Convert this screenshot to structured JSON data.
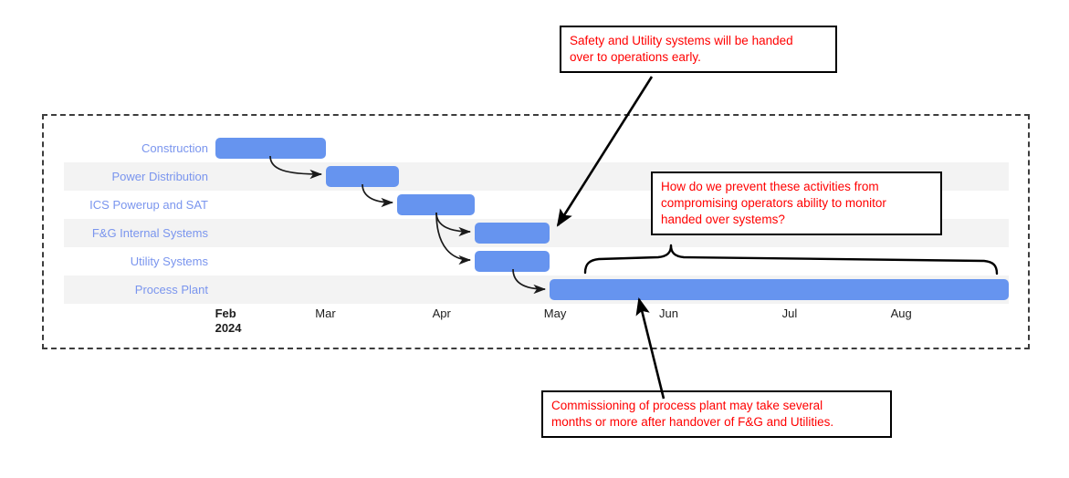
{
  "chart_data": {
    "type": "gantt",
    "title": "",
    "xlabel": "",
    "ylabel": "",
    "axis_ticks": [
      {
        "label": "Feb",
        "year": "2024",
        "x_pct": 16.0,
        "bold": true
      },
      {
        "label": "Mar",
        "year": "",
        "x_pct": 26.6,
        "bold": false
      },
      {
        "label": "Apr",
        "year": "",
        "x_pct": 39.0,
        "bold": false
      },
      {
        "label": "May",
        "year": "",
        "x_pct": 50.8,
        "bold": false
      },
      {
        "label": "Jun",
        "year": "",
        "x_pct": 63.0,
        "bold": false
      },
      {
        "label": "Jul",
        "year": "",
        "x_pct": 76.0,
        "bold": false
      },
      {
        "label": "Aug",
        "year": "",
        "x_pct": 87.5,
        "bold": false
      }
    ],
    "bar_color": "#6694ef",
    "label_color": "#7a95ee",
    "tasks": [
      {
        "name": "Construction",
        "start_pct": 16.0,
        "end_pct": 27.7
      },
      {
        "name": "Power Distribution",
        "start_pct": 27.7,
        "end_pct": 35.5
      },
      {
        "name": "ICS Powerup and SAT",
        "start_pct": 35.3,
        "end_pct": 43.5
      },
      {
        "name": "F&G Internal Systems",
        "start_pct": 43.5,
        "end_pct": 51.4
      },
      {
        "name": "Utility Systems",
        "start_pct": 43.5,
        "end_pct": 51.4
      },
      {
        "name": "Process Plant",
        "start_pct": 51.4,
        "end_pct": 100.0
      }
    ],
    "dependencies": [
      {
        "from": "Construction",
        "to": "Power Distribution"
      },
      {
        "from": "Power Distribution",
        "to": "ICS Powerup and SAT"
      },
      {
        "from": "ICS Powerup and SAT",
        "to": "F&G Internal Systems"
      },
      {
        "from": "ICS Powerup and SAT",
        "to": "Utility Systems"
      },
      {
        "from": "Utility Systems",
        "to": "Process Plant"
      }
    ],
    "grid": false,
    "legend": "none"
  },
  "annotations": {
    "top": {
      "lines": [
        "Safety and Utility systems will be handed",
        "over to operations early."
      ],
      "color": "#ff0000"
    },
    "middle": {
      "lines": [
        "How do we prevent these activities from",
        "compromising operators ability to monitor",
        "handed over systems?"
      ],
      "color": "#ff0000"
    },
    "bottom": {
      "lines": [
        "Commissioning of process plant may take several",
        "months or more after handover of F&G and Utilities."
      ],
      "color": "#ff0000"
    }
  }
}
